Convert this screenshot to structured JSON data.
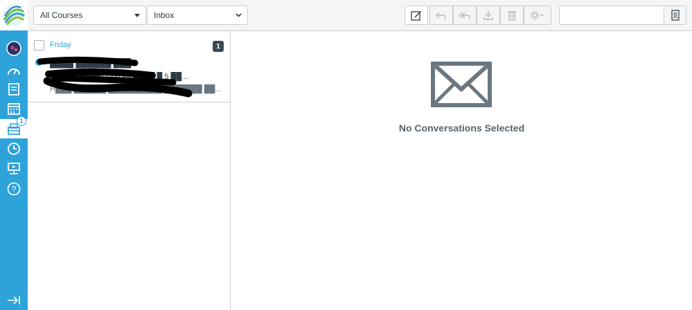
{
  "filters": {
    "course_select": "All Courses",
    "mailbox_select": "Inbox"
  },
  "global_nav": {
    "inbox_badge": "1",
    "active_item": "inbox"
  },
  "conversation_list": [
    {
      "date": "Friday",
      "count": "1",
      "participants": "████ ██████ ███",
      "subject": "█████ ████ission for ████ █ 5 ██...",
      "preview": "H███ ██████ ██████████ ███████ ██...",
      "unread": true
    }
  ],
  "empty_state": {
    "title": "No Conversations Selected"
  },
  "colors": {
    "nav": "#2ea3d9",
    "header_bg": "#f5f5f5",
    "border": "#c7cdd1",
    "text": "#2d3b45",
    "envelope": "#6b7780"
  },
  "icons": [
    "compose-icon",
    "reply-icon",
    "reply-all-icon",
    "archive-icon",
    "delete-icon",
    "settings-icon",
    "address-book-icon"
  ]
}
